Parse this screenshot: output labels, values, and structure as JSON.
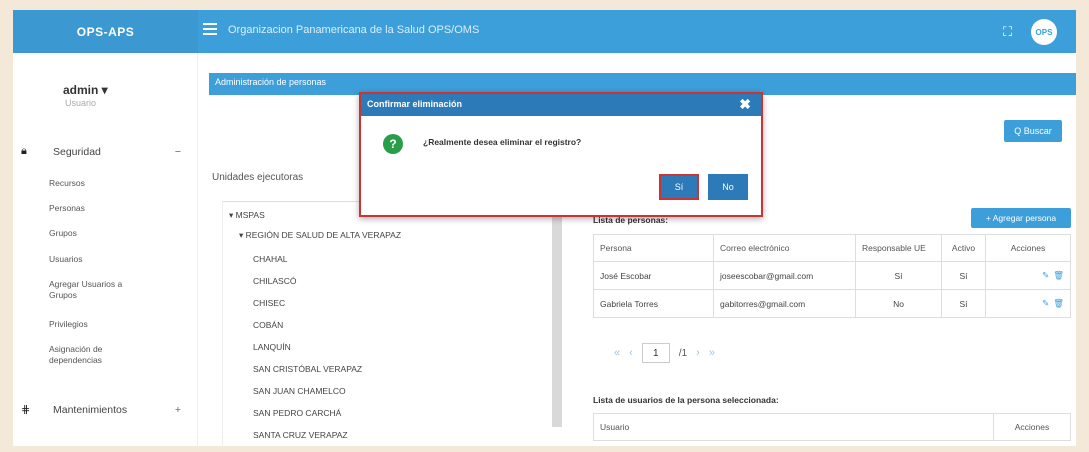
{
  "topbar": {
    "brand": "OPS-APS",
    "org_title": "Organizacion Panamericana de la Salud  OPS/OMS",
    "avatar_text": "OPS"
  },
  "sidebar": {
    "user_name": "admin ▾",
    "user_role": "Usuario",
    "security": {
      "label": "Seguridad",
      "toggle": "−"
    },
    "items": [
      "Recursos",
      "Personas",
      "Grupos",
      "Usuarios",
      "Agregar Usuarios a Grupos",
      "Privilegios",
      "Asignación de dependencias"
    ],
    "maintenance": {
      "label": "Mantenimientos",
      "toggle": "+"
    }
  },
  "main": {
    "section_title": "Administración de personas",
    "search_label": "Q Buscar",
    "units_label": "Unidades ejecutoras",
    "tree": {
      "root": "▾ MSPAS",
      "region": "▾ REGIÓN DE SALUD DE ALTA VERAPAZ",
      "places": [
        "CHAHAL",
        "CHILASCÓ",
        "CHISEC",
        "COBÁN",
        "LANQUÍN",
        "SAN CRISTÓBAL VERAPAZ",
        "SAN JUAN CHAMELCO",
        "SAN PEDRO CARCHÁ",
        "SANTA CRUZ VERAPAZ"
      ]
    },
    "persons": {
      "title": "Lista de personas:",
      "add_label": "+ Agregar persona",
      "columns": [
        "Persona",
        "Correo electrónico",
        "Responsable UE",
        "Activo",
        "Acciones"
      ],
      "rows": [
        [
          "José Escobar",
          "joseescobar@gmail.com",
          "Sí",
          "Sí"
        ],
        [
          "Gabriela Torres",
          "gabitorres@gmail.com",
          "No",
          "Sí"
        ]
      ],
      "pager": {
        "first": "«",
        "prev": "‹",
        "page": "1",
        "total": "/1",
        "next": "›",
        "last": "»"
      }
    },
    "users": {
      "title": "Lista de usuarios de la persona seleccionada:",
      "columns": [
        "Usuario",
        "Acciones"
      ]
    }
  },
  "modal": {
    "title": "Confirmar eliminación",
    "close": "✖",
    "icon": "?",
    "message": "¿Realmente desea eliminar el registro?",
    "yes": "Sí",
    "no": "No"
  }
}
